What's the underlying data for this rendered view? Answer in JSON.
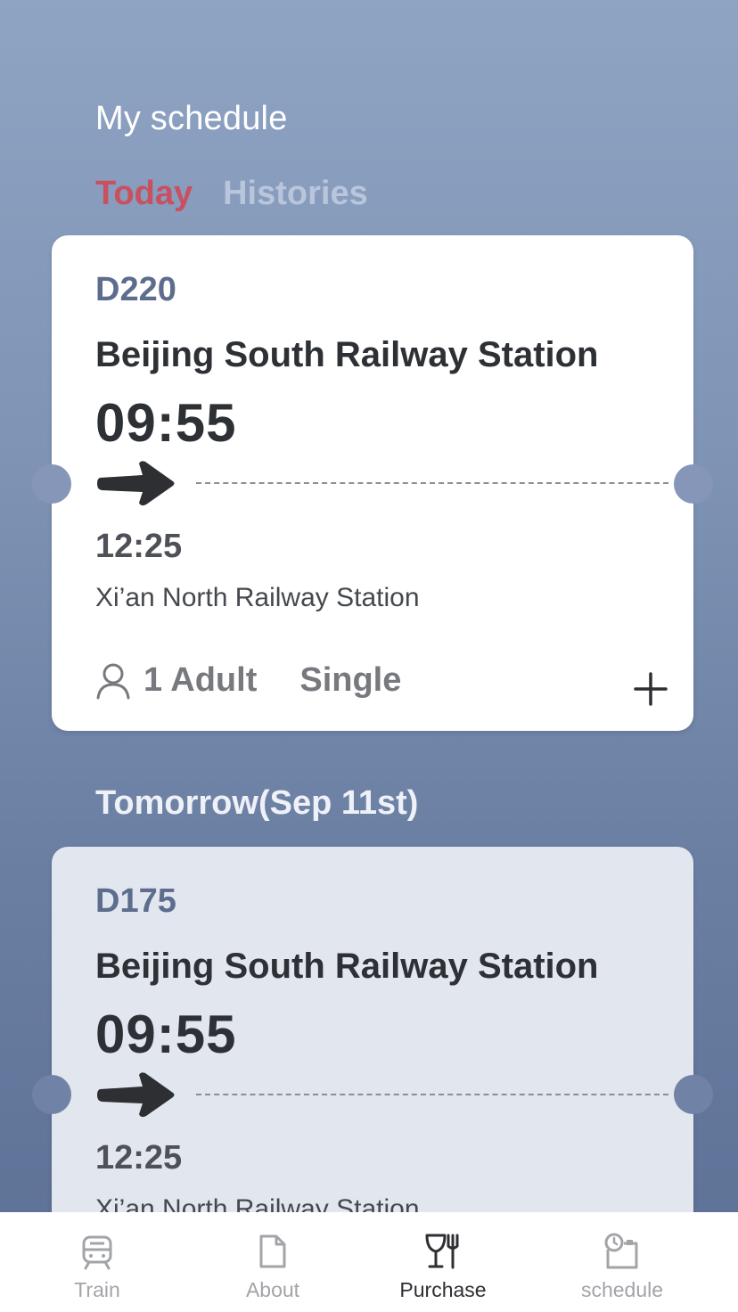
{
  "header": {
    "title": "My schedule"
  },
  "tabs": [
    {
      "label": "Today",
      "active": true
    },
    {
      "label": "Histories",
      "active": false
    }
  ],
  "today_ticket": {
    "train_no": "D220",
    "departure_station": "Beijing South Railway Station",
    "departure_time": "09:55",
    "arrival_time": "12:25",
    "arrival_station": "Xi’an North Railway Station",
    "passengers": "1 Adult",
    "trip_type": "Single"
  },
  "tomorrow_section": {
    "label": "Tomorrow(Sep 11st)"
  },
  "tomorrow_ticket": {
    "train_no": "D175",
    "departure_station": "Beijing South Railway Station",
    "departure_time": "09:55",
    "arrival_time": "12:25",
    "arrival_station": "Xi’an North Railway Station"
  },
  "tabbar": [
    {
      "label": "Train",
      "icon": "train-icon",
      "active": false
    },
    {
      "label": "About",
      "icon": "document-icon",
      "active": false
    },
    {
      "label": "Purchase",
      "icon": "fork-knife-icon",
      "active": true
    },
    {
      "label": "schedule",
      "icon": "clock-calendar-icon",
      "active": false
    }
  ],
  "colors": {
    "accent": "#c8505f",
    "train_no": "#5d6d8d",
    "text_dark": "#2d3035",
    "inactive_tab": "#b9c5db"
  }
}
